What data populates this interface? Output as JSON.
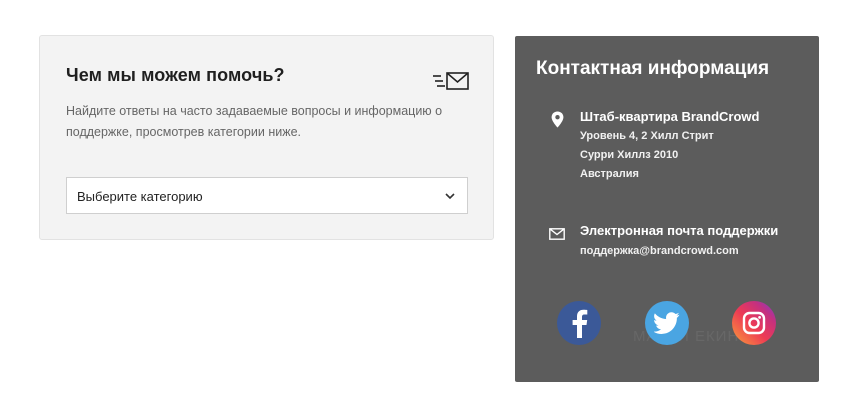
{
  "help": {
    "title": "Чем мы можем помочь?",
    "description": "Найдите ответы на часто задаваемые вопросы и информацию о поддержке, просмотрев категории ниже.",
    "select": {
      "selected": "Выберите категорию"
    },
    "icon": "fast-mail-icon"
  },
  "contact": {
    "title": "Контактная информация",
    "hq": {
      "icon": "location-pin-icon",
      "title": "Штаб-квартира BrandCrowd",
      "lines": [
        "Уровень 4, 2 Хилл Стрит",
        "Сурри Хиллз 2010",
        "Австралия"
      ]
    },
    "email": {
      "icon": "envelope-icon",
      "title": "Электронная почта поддержки",
      "value": "поддержка@brandcrowd.com"
    },
    "social": [
      "facebook-icon",
      "twitter-icon",
      "instagram-icon"
    ],
    "watermark": "МАРТИ  ЕКИН"
  },
  "colors": {
    "help_bg": "#f3f3f3",
    "contact_bg": "#5c5c5c",
    "facebook": "#3b5998",
    "twitter": "#4aa5e2",
    "instagram": "#e1306c"
  }
}
